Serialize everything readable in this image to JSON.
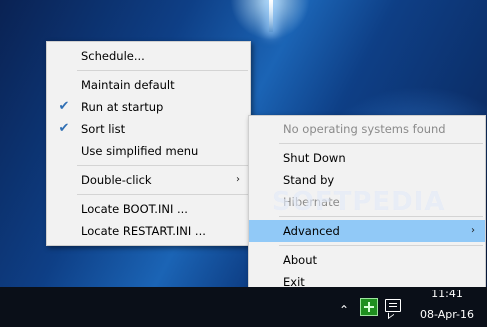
{
  "main_menu": {
    "items": [
      {
        "label": "Schedule...",
        "checked": false
      },
      {
        "label": "Maintain default",
        "checked": false
      },
      {
        "label": "Run at startup",
        "checked": true
      },
      {
        "label": "Sort list",
        "checked": true
      },
      {
        "label": "Use simplified menu",
        "checked": false
      },
      {
        "label": "Double-click",
        "checked": false,
        "submenu": true
      },
      {
        "label": "Locate BOOT.INI ...",
        "checked": false
      },
      {
        "label": "Locate RESTART.INI ...",
        "checked": false
      }
    ],
    "check_glyph": "✔",
    "submenu_glyph": "›"
  },
  "power_menu": {
    "items": [
      {
        "label": "No operating systems found",
        "disabled": true
      },
      {
        "label": "Shut Down",
        "disabled": false
      },
      {
        "label": "Stand by",
        "disabled": false
      },
      {
        "label": "Hibernate",
        "disabled": true
      },
      {
        "label": "Advanced",
        "disabled": false,
        "submenu": true,
        "highlighted": true
      },
      {
        "label": "About",
        "disabled": false
      },
      {
        "label": "Exit",
        "disabled": false
      }
    ],
    "submenu_glyph": "›"
  },
  "watermark": "SOFTPEDIA",
  "taskbar": {
    "tray_chevron": "⌃",
    "clock_time": "11:41",
    "clock_date": "08-Apr-16"
  },
  "colors": {
    "menu_bg": "#f2f2f2",
    "highlight": "#91c9f7",
    "disabled_text": "#8a8a8a",
    "check": "#2f6fb4",
    "taskbar": "#0a0f18"
  }
}
